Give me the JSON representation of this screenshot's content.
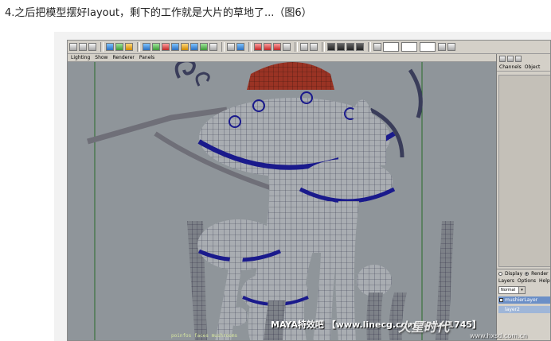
{
  "caption": "4.之后把模型摆好layout，剩下的工作就是大片的草地了...（图6）",
  "viewport_menu": [
    "Lighting",
    "Show",
    "Renderer",
    "Panels"
  ],
  "right_panel": {
    "tabs": [
      "Channels",
      "Object"
    ],
    "display_radio": "Display",
    "render_radio": "Render",
    "layer_menu": [
      "Layers",
      "Options",
      "Help"
    ],
    "blend_mode": "Normal",
    "layer_badge": "layer2",
    "layer_name": "mushierLayer"
  },
  "hud_text": "poinfos  faces  mushrooms",
  "watermark": {
    "text": "MAYA特效吧 【www.linecg.com/tieba/1745】",
    "logo": "火星时代",
    "logo_url": "www.hxsd.com.cn"
  },
  "colors": {
    "viewport_bg": "#8f959a",
    "wire_blue": "#1a1a8c",
    "cap_red": "#8a2a1e",
    "ui_gray": "#d4d0c8"
  }
}
